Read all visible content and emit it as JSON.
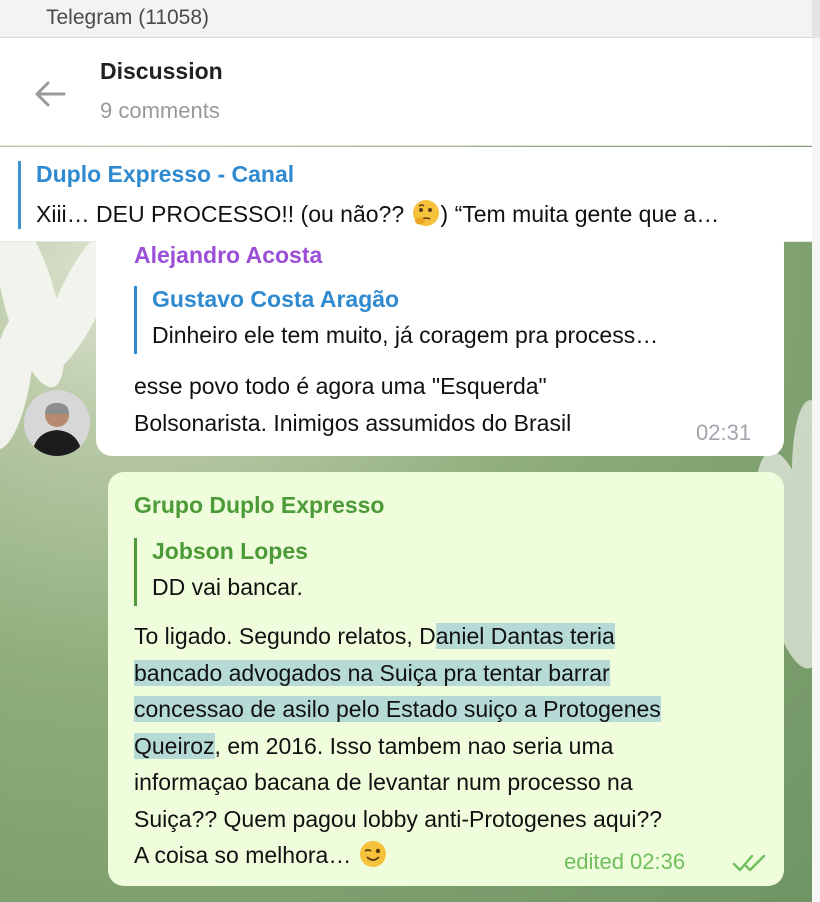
{
  "window": {
    "title": "Telegram (11058)"
  },
  "header": {
    "title": "Discussion",
    "subtitle": "9 comments",
    "back_icon": "arrow-left-icon"
  },
  "pinned": {
    "channel": "Duplo Expresso - Canal",
    "text_before": "Xiii… DEU PROCESSO!! (ou não?? ",
    "text_after": ") “Tem muita gente que a…"
  },
  "messages": [
    {
      "sender": "Alejandro Acosta",
      "sender_color": "#9a4fd6",
      "reply": {
        "name": "Gustavo Costa Aragão",
        "text": "Dinheiro ele tem muito, já coragem pra process…",
        "color": "#2f8ad0"
      },
      "lines": [
        "esse povo todo é agora uma \"Esquerda\"",
        "Bolsonarista. Inimigos assumidos do Brasil"
      ],
      "time": "02:31"
    },
    {
      "sender": "Grupo Duplo Expresso",
      "sender_color": "#4c9a38",
      "reply": {
        "name": "Jobson Lopes",
        "text": "DD vai bancar.",
        "color": "#4c9a38"
      },
      "text_line1_plain": "To ligado. Segundo relatos, D",
      "text_line1_hl": "aniel Dantas teria",
      "text_line2_hl": "bancado advogados na Suiça pra tentar barrar",
      "text_line3_hl": "concessao de asilo pelo Estado suiço a Protogenes",
      "text_line4_hl": "Queiroz",
      "text_line4_plain": ", em 2016. Isso tambem nao seria uma",
      "text_line5": "informaçao bacana de levantar num processo na",
      "text_line6": "Suiça?? Quem pagou lobby anti-Protogenes aqui??",
      "text_line7": "A coisa so melhora… ",
      "time": "edited 02:36",
      "status_icon": "double-check-icon"
    }
  ],
  "colors": {
    "accent": "#2f8ad0",
    "bubble_out": "#effddd",
    "bubble_in": "#ffffff",
    "time_out": "#6fbf5c",
    "time_in": "#a0a6ab"
  }
}
